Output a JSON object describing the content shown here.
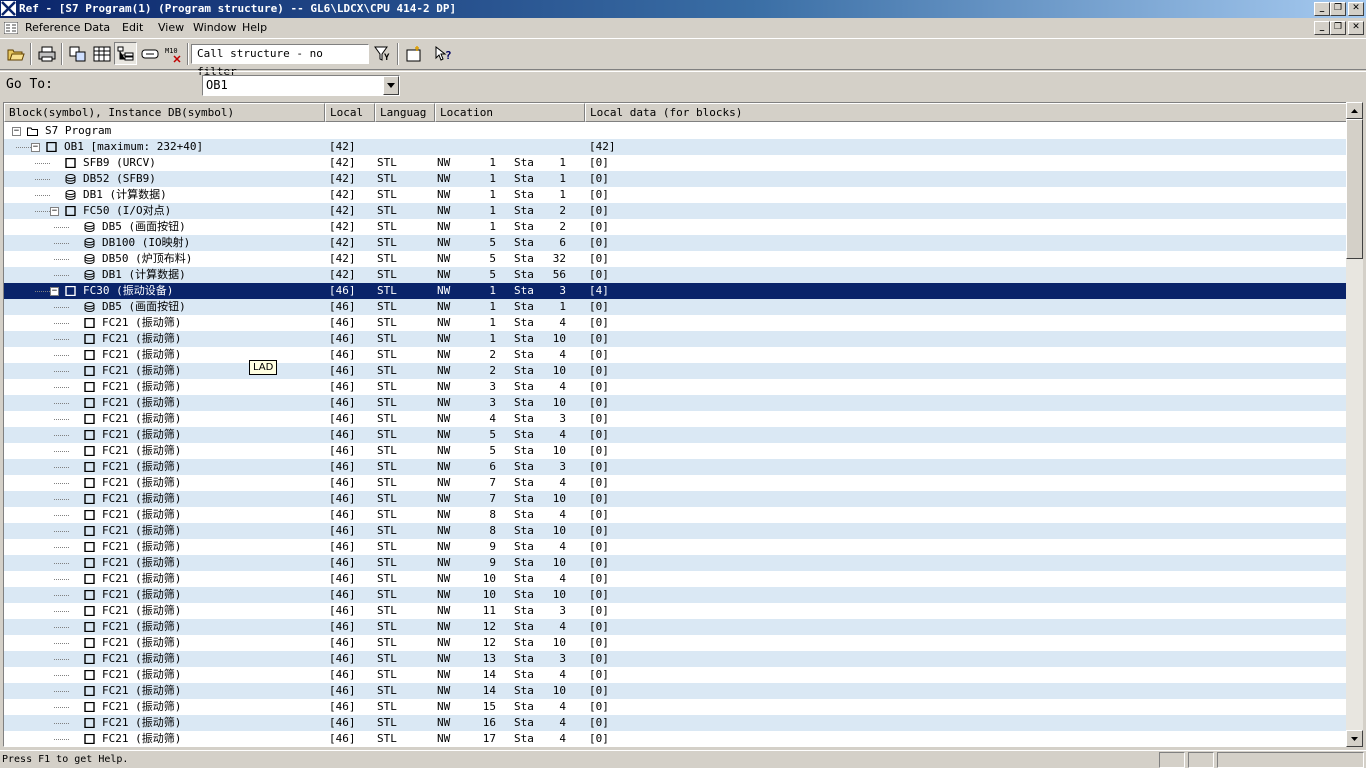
{
  "window": {
    "title": "Ref - [S7 Program(1) (Program structure) -- GL6\\LDCX\\CPU 414-2 DP]"
  },
  "menu": [
    "Reference Data",
    "Edit",
    "View",
    "Window",
    "Help"
  ],
  "toolbar": {
    "buttons": [
      "open-icon",
      "print-icon",
      "cross-reference-icon",
      "assignment-icon",
      "program-structure-icon",
      "unused-symbols-icon",
      "addresses-without-symbols-icon",
      "filter-icon",
      "new-window-icon",
      "help-icon"
    ],
    "filter_value": "Call structure - no filter"
  },
  "goto": {
    "label": "Go To:",
    "value": "OB1"
  },
  "columns": [
    "Block(symbol), Instance DB(symbol)",
    "Local",
    "Languag",
    "Location",
    "Local data (for blocks)"
  ],
  "rows": [
    {
      "level": 0,
      "icon": "folder",
      "exp": "-",
      "name": "S7 Program",
      "local": "",
      "lang": "",
      "nw": "",
      "nwn": "",
      "sta": "",
      "stan": "",
      "ld": ""
    },
    {
      "level": 1,
      "icon": "block",
      "exp": "-",
      "name": "OB1 [maximum: 232+40]",
      "local": "[42]",
      "lang": "",
      "nw": "",
      "nwn": "",
      "sta": "",
      "stan": "",
      "ld": "[42]"
    },
    {
      "level": 2,
      "icon": "block",
      "exp": "",
      "name": "SFB9 (URCV)",
      "local": "[42]",
      "lang": "STL",
      "nw": "NW",
      "nwn": "1",
      "sta": "Sta",
      "stan": "1",
      "ld": "[0]"
    },
    {
      "level": 2,
      "icon": "db",
      "exp": "",
      "name": "DB52 (SFB9)",
      "local": "[42]",
      "lang": "STL",
      "nw": "NW",
      "nwn": "1",
      "sta": "Sta",
      "stan": "1",
      "ld": "[0]"
    },
    {
      "level": 2,
      "icon": "db",
      "exp": "",
      "name": "DB1 (计算数据)",
      "local": "[42]",
      "lang": "STL",
      "nw": "NW",
      "nwn": "1",
      "sta": "Sta",
      "stan": "1",
      "ld": "[0]"
    },
    {
      "level": 2,
      "icon": "block",
      "exp": "-",
      "name": "FC50 (I/O对点)",
      "local": "[42]",
      "lang": "STL",
      "nw": "NW",
      "nwn": "1",
      "sta": "Sta",
      "stan": "2",
      "ld": "[0]"
    },
    {
      "level": 3,
      "icon": "db",
      "exp": "",
      "name": "DB5 (画面按钮)",
      "local": "[42]",
      "lang": "STL",
      "nw": "NW",
      "nwn": "1",
      "sta": "Sta",
      "stan": "2",
      "ld": "[0]"
    },
    {
      "level": 3,
      "icon": "db",
      "exp": "",
      "name": "DB100 (IO映射)",
      "local": "[42]",
      "lang": "STL",
      "nw": "NW",
      "nwn": "5",
      "sta": "Sta",
      "stan": "6",
      "ld": "[0]"
    },
    {
      "level": 3,
      "icon": "db",
      "exp": "",
      "name": "DB50 (炉顶布料)",
      "local": "[42]",
      "lang": "STL",
      "nw": "NW",
      "nwn": "5",
      "sta": "Sta",
      "stan": "32",
      "ld": "[0]"
    },
    {
      "level": 3,
      "icon": "db",
      "exp": "",
      "name": "DB1 (计算数据)",
      "local": "[42]",
      "lang": "STL",
      "nw": "NW",
      "nwn": "5",
      "sta": "Sta",
      "stan": "56",
      "ld": "[0]"
    },
    {
      "level": 2,
      "icon": "block",
      "exp": "-",
      "name": "FC30 (振动设备)",
      "local": "[46]",
      "lang": "STL",
      "nw": "NW",
      "nwn": "1",
      "sta": "Sta",
      "stan": "3",
      "ld": "[4]",
      "selected": true
    },
    {
      "level": 3,
      "icon": "db",
      "exp": "",
      "name": "DB5 (画面按钮)",
      "local": "[46]",
      "lang": "STL",
      "nw": "NW",
      "nwn": "1",
      "sta": "Sta",
      "stan": "1",
      "ld": "[0]"
    },
    {
      "level": 3,
      "icon": "block",
      "exp": "",
      "name": "FC21 (振动筛)",
      "local": "[46]",
      "lang": "STL",
      "nw": "NW",
      "nwn": "1",
      "sta": "Sta",
      "stan": "4",
      "ld": "[0]"
    },
    {
      "level": 3,
      "icon": "block",
      "exp": "",
      "name": "FC21 (振动筛)",
      "local": "[46]",
      "lang": "STL",
      "nw": "NW",
      "nwn": "1",
      "sta": "Sta",
      "stan": "10",
      "ld": "[0]"
    },
    {
      "level": 3,
      "icon": "block",
      "exp": "",
      "name": "FC21 (振动筛)",
      "local": "[46]",
      "lang": "STL",
      "nw": "NW",
      "nwn": "2",
      "sta": "Sta",
      "stan": "4",
      "ld": "[0]"
    },
    {
      "level": 3,
      "icon": "block",
      "exp": "",
      "name": "FC21 (振动筛)",
      "local": "[46]",
      "lang": "STL",
      "nw": "NW",
      "nwn": "2",
      "sta": "Sta",
      "stan": "10",
      "ld": "[0]"
    },
    {
      "level": 3,
      "icon": "block",
      "exp": "",
      "name": "FC21 (振动筛)",
      "local": "[46]",
      "lang": "STL",
      "nw": "NW",
      "nwn": "3",
      "sta": "Sta",
      "stan": "4",
      "ld": "[0]"
    },
    {
      "level": 3,
      "icon": "block",
      "exp": "",
      "name": "FC21 (振动筛)",
      "local": "[46]",
      "lang": "STL",
      "nw": "NW",
      "nwn": "3",
      "sta": "Sta",
      "stan": "10",
      "ld": "[0]"
    },
    {
      "level": 3,
      "icon": "block",
      "exp": "",
      "name": "FC21 (振动筛)",
      "local": "[46]",
      "lang": "STL",
      "nw": "NW",
      "nwn": "4",
      "sta": "Sta",
      "stan": "3",
      "ld": "[0]"
    },
    {
      "level": 3,
      "icon": "block",
      "exp": "",
      "name": "FC21 (振动筛)",
      "local": "[46]",
      "lang": "STL",
      "nw": "NW",
      "nwn": "5",
      "sta": "Sta",
      "stan": "4",
      "ld": "[0]"
    },
    {
      "level": 3,
      "icon": "block",
      "exp": "",
      "name": "FC21 (振动筛)",
      "local": "[46]",
      "lang": "STL",
      "nw": "NW",
      "nwn": "5",
      "sta": "Sta",
      "stan": "10",
      "ld": "[0]"
    },
    {
      "level": 3,
      "icon": "block",
      "exp": "",
      "name": "FC21 (振动筛)",
      "local": "[46]",
      "lang": "STL",
      "nw": "NW",
      "nwn": "6",
      "sta": "Sta",
      "stan": "3",
      "ld": "[0]"
    },
    {
      "level": 3,
      "icon": "block",
      "exp": "",
      "name": "FC21 (振动筛)",
      "local": "[46]",
      "lang": "STL",
      "nw": "NW",
      "nwn": "7",
      "sta": "Sta",
      "stan": "4",
      "ld": "[0]"
    },
    {
      "level": 3,
      "icon": "block",
      "exp": "",
      "name": "FC21 (振动筛)",
      "local": "[46]",
      "lang": "STL",
      "nw": "NW",
      "nwn": "7",
      "sta": "Sta",
      "stan": "10",
      "ld": "[0]"
    },
    {
      "level": 3,
      "icon": "block",
      "exp": "",
      "name": "FC21 (振动筛)",
      "local": "[46]",
      "lang": "STL",
      "nw": "NW",
      "nwn": "8",
      "sta": "Sta",
      "stan": "4",
      "ld": "[0]"
    },
    {
      "level": 3,
      "icon": "block",
      "exp": "",
      "name": "FC21 (振动筛)",
      "local": "[46]",
      "lang": "STL",
      "nw": "NW",
      "nwn": "8",
      "sta": "Sta",
      "stan": "10",
      "ld": "[0]"
    },
    {
      "level": 3,
      "icon": "block",
      "exp": "",
      "name": "FC21 (振动筛)",
      "local": "[46]",
      "lang": "STL",
      "nw": "NW",
      "nwn": "9",
      "sta": "Sta",
      "stan": "4",
      "ld": "[0]"
    },
    {
      "level": 3,
      "icon": "block",
      "exp": "",
      "name": "FC21 (振动筛)",
      "local": "[46]",
      "lang": "STL",
      "nw": "NW",
      "nwn": "9",
      "sta": "Sta",
      "stan": "10",
      "ld": "[0]"
    },
    {
      "level": 3,
      "icon": "block",
      "exp": "",
      "name": "FC21 (振动筛)",
      "local": "[46]",
      "lang": "STL",
      "nw": "NW",
      "nwn": "10",
      "sta": "Sta",
      "stan": "4",
      "ld": "[0]"
    },
    {
      "level": 3,
      "icon": "block",
      "exp": "",
      "name": "FC21 (振动筛)",
      "local": "[46]",
      "lang": "STL",
      "nw": "NW",
      "nwn": "10",
      "sta": "Sta",
      "stan": "10",
      "ld": "[0]"
    },
    {
      "level": 3,
      "icon": "block",
      "exp": "",
      "name": "FC21 (振动筛)",
      "local": "[46]",
      "lang": "STL",
      "nw": "NW",
      "nwn": "11",
      "sta": "Sta",
      "stan": "3",
      "ld": "[0]"
    },
    {
      "level": 3,
      "icon": "block",
      "exp": "",
      "name": "FC21 (振动筛)",
      "local": "[46]",
      "lang": "STL",
      "nw": "NW",
      "nwn": "12",
      "sta": "Sta",
      "stan": "4",
      "ld": "[0]"
    },
    {
      "level": 3,
      "icon": "block",
      "exp": "",
      "name": "FC21 (振动筛)",
      "local": "[46]",
      "lang": "STL",
      "nw": "NW",
      "nwn": "12",
      "sta": "Sta",
      "stan": "10",
      "ld": "[0]"
    },
    {
      "level": 3,
      "icon": "block",
      "exp": "",
      "name": "FC21 (振动筛)",
      "local": "[46]",
      "lang": "STL",
      "nw": "NW",
      "nwn": "13",
      "sta": "Sta",
      "stan": "3",
      "ld": "[0]"
    },
    {
      "level": 3,
      "icon": "block",
      "exp": "",
      "name": "FC21 (振动筛)",
      "local": "[46]",
      "lang": "STL",
      "nw": "NW",
      "nwn": "14",
      "sta": "Sta",
      "stan": "4",
      "ld": "[0]"
    },
    {
      "level": 3,
      "icon": "block",
      "exp": "",
      "name": "FC21 (振动筛)",
      "local": "[46]",
      "lang": "STL",
      "nw": "NW",
      "nwn": "14",
      "sta": "Sta",
      "stan": "10",
      "ld": "[0]"
    },
    {
      "level": 3,
      "icon": "block",
      "exp": "",
      "name": "FC21 (振动筛)",
      "local": "[46]",
      "lang": "STL",
      "nw": "NW",
      "nwn": "15",
      "sta": "Sta",
      "stan": "4",
      "ld": "[0]"
    },
    {
      "level": 3,
      "icon": "block",
      "exp": "",
      "name": "FC21 (振动筛)",
      "local": "[46]",
      "lang": "STL",
      "nw": "NW",
      "nwn": "16",
      "sta": "Sta",
      "stan": "4",
      "ld": "[0]"
    },
    {
      "level": 3,
      "icon": "block",
      "exp": "",
      "name": "FC21 (振动筛)",
      "local": "[46]",
      "lang": "STL",
      "nw": "NW",
      "nwn": "17",
      "sta": "Sta",
      "stan": "4",
      "ld": "[0]"
    }
  ],
  "tooltip": "LAD",
  "status": "Press F1 to get Help.",
  "colors": {
    "selection": "#0a246a",
    "alt_row": "#dae8f4",
    "title_start": "#0a246a",
    "title_end": "#a6caf0"
  }
}
